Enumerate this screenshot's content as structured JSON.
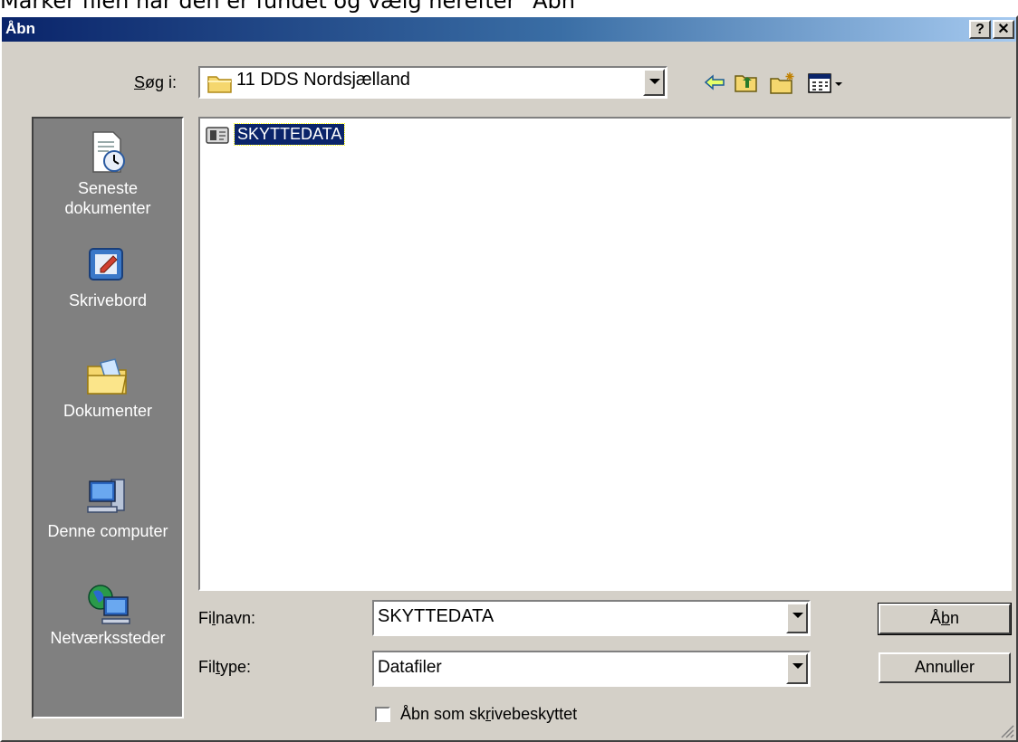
{
  "instruction": "Marker filen når den er fundet og vælg herefter \"Åbn\"",
  "window": {
    "title": "Åbn",
    "help_label": "?",
    "close_label": "✕"
  },
  "look_in": {
    "label_prefix": "",
    "label_u": "S",
    "label_rest": "øg i:",
    "value": "11 DDS Nordsjælland"
  },
  "toolbar": {
    "back_icon": "back-arrow-icon",
    "up_icon": "up-folder-icon",
    "new_folder_icon": "new-folder-icon",
    "view_icon": "view-menu-icon"
  },
  "places": [
    {
      "label": "Seneste dokumenter",
      "icon": "recent-documents-icon"
    },
    {
      "label": "Skrivebord",
      "icon": "desktop-icon"
    },
    {
      "label": "Dokumenter",
      "icon": "documents-folder-icon"
    },
    {
      "label": "Denne computer",
      "icon": "my-computer-icon"
    },
    {
      "label": "Netværkssteder",
      "icon": "network-places-icon"
    }
  ],
  "files": [
    {
      "name": "SKYTTEDATA",
      "selected": true
    }
  ],
  "filename": {
    "label_a": "Fi",
    "label_u": "l",
    "label_b": "navn:",
    "value": "SKYTTEDATA"
  },
  "filetype": {
    "label_a": "Fil",
    "label_u": "t",
    "label_b": "ype:",
    "value": "Datafiler"
  },
  "readonly": {
    "label_a": "Åbn som sk",
    "label_u": "r",
    "label_b": "ivebeskyttet",
    "checked": false
  },
  "buttons": {
    "open_a": "Å",
    "open_u": "b",
    "open_b": "n",
    "cancel": "Annuller"
  },
  "colors": {
    "title_start": "#0a246a",
    "title_end": "#a6caf0",
    "dialog_bg": "#d4d0c8",
    "places_bg": "#808080",
    "selection": "#0a246a"
  }
}
